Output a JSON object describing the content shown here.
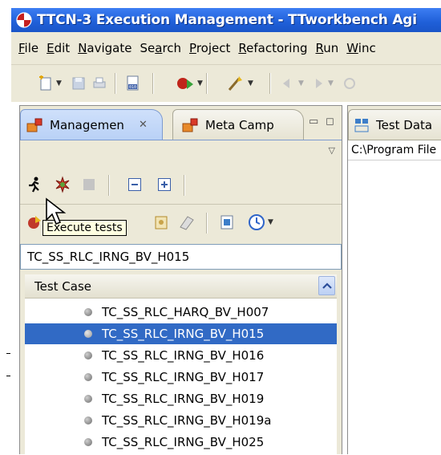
{
  "window": {
    "title": "TTCN-3 Execution Management - TTworkbench Agi"
  },
  "menu": [
    "File",
    "Edit",
    "Navigate",
    "Search",
    "Project",
    "Refactoring",
    "Run",
    "Winc"
  ],
  "menu_mnemonics": [
    "F",
    "E",
    "N",
    "a",
    "P",
    "R",
    "R",
    "W"
  ],
  "left_view": {
    "tabs": [
      {
        "label": "Managemen",
        "active": true
      },
      {
        "label": "Meta Camp",
        "active": false
      }
    ],
    "tooltip": "Execute tests",
    "test_name_field": "TC_SS_RLC_IRNG_BV_H015",
    "table": {
      "column_header": "Test Case",
      "rows": [
        {
          "name": "TC_SS_RLC_HARQ_BV_H007",
          "selected": false
        },
        {
          "name": "TC_SS_RLC_IRNG_BV_H015",
          "selected": true
        },
        {
          "name": "TC_SS_RLC_IRNG_BV_H016",
          "selected": false
        },
        {
          "name": "TC_SS_RLC_IRNG_BV_H017",
          "selected": false
        },
        {
          "name": "TC_SS_RLC_IRNG_BV_H019",
          "selected": false
        },
        {
          "name": "TC_SS_RLC_IRNG_BV_H019a",
          "selected": false
        },
        {
          "name": "TC_SS_RLC_IRNG_BV_H025",
          "selected": false
        }
      ]
    }
  },
  "right_view": {
    "tab_label": "Test Data",
    "path": "C:\\Program File"
  },
  "colors": {
    "titlebar": "#2563e0",
    "selection": "#316ac5",
    "chrome": "#ece9d8",
    "tooltip": "#ffffe1"
  }
}
